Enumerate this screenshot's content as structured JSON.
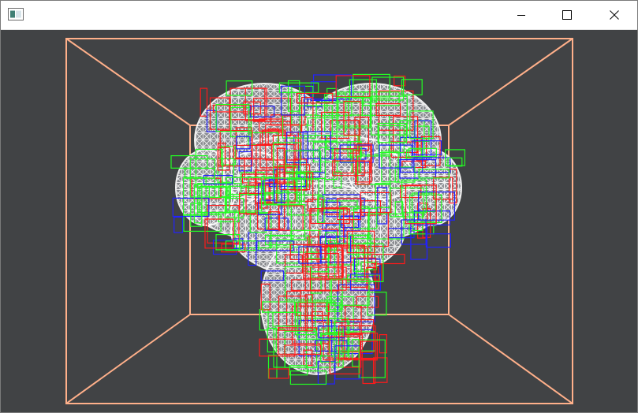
{
  "window": {
    "title": "",
    "icon": "app-window-icon",
    "controls": {
      "minimize_icon": "minimize-icon",
      "maximize_icon": "maximize-icon",
      "close_icon": "close-icon"
    }
  },
  "viewport": {
    "background_color": "#414345",
    "scene": "wireframe-mesh-with-bounding-boxes",
    "colors": {
      "room_lines": "#ffb08a",
      "mesh": "#ffffff",
      "boxes_red": "#ff1a1a",
      "boxes_green": "#22ff22",
      "boxes_blue": "#2222ff"
    }
  }
}
